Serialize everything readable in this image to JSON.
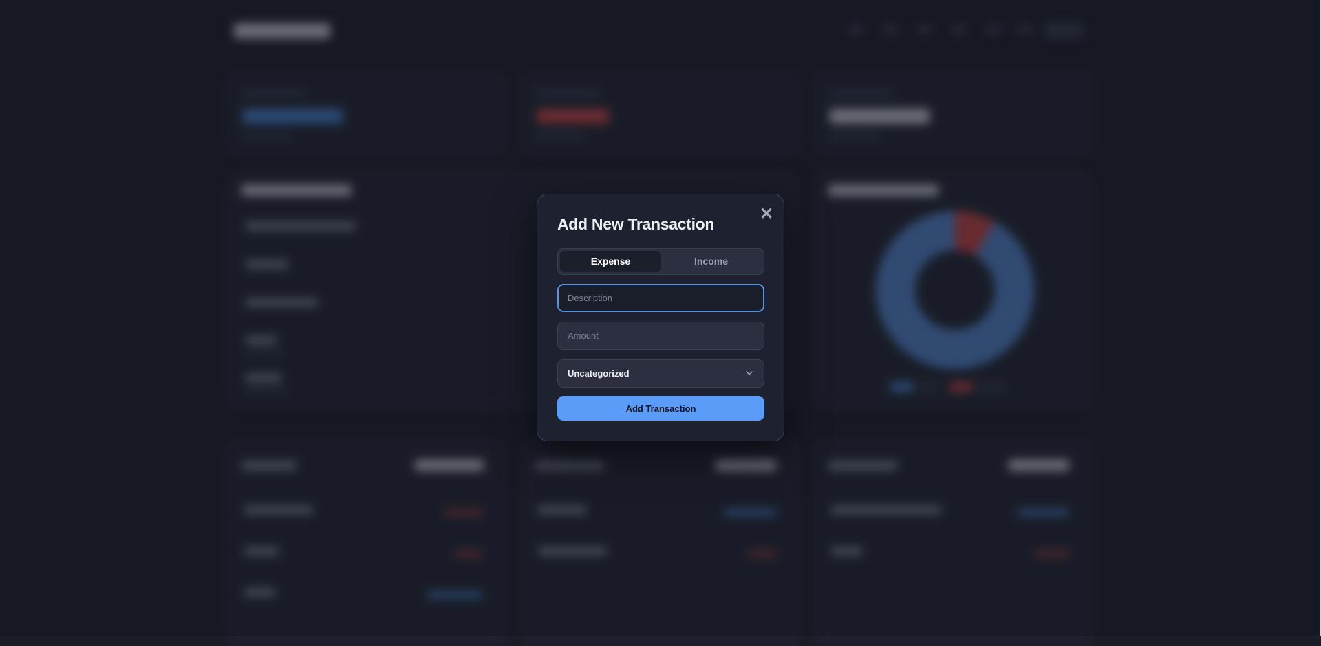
{
  "modal": {
    "title": "Add New Transaction",
    "close_icon": "close-icon",
    "type_toggle": {
      "options": [
        "Expense",
        "Income"
      ],
      "selected": "Expense"
    },
    "description": {
      "placeholder": "Description",
      "value": ""
    },
    "amount": {
      "placeholder": "Amount",
      "value": ""
    },
    "category": {
      "selected": "Uncategorized",
      "icon": "chevron-down-icon"
    },
    "submit_label": "Add Transaction"
  },
  "colors": {
    "accent": "#5b9cf8",
    "focus_ring": "#5b8fe0",
    "expense_red": "#e04848",
    "income_blue": "#5b94e8",
    "modal_bg": "#1e2130",
    "page_bg": "#1a1d27"
  },
  "background": {
    "state": "blurred-dashboard",
    "donut_chart": {
      "series": [
        {
          "color": "#e04848",
          "fraction": 0.08
        },
        {
          "color": "#5b94e8",
          "fraction": 0.92
        }
      ]
    }
  }
}
